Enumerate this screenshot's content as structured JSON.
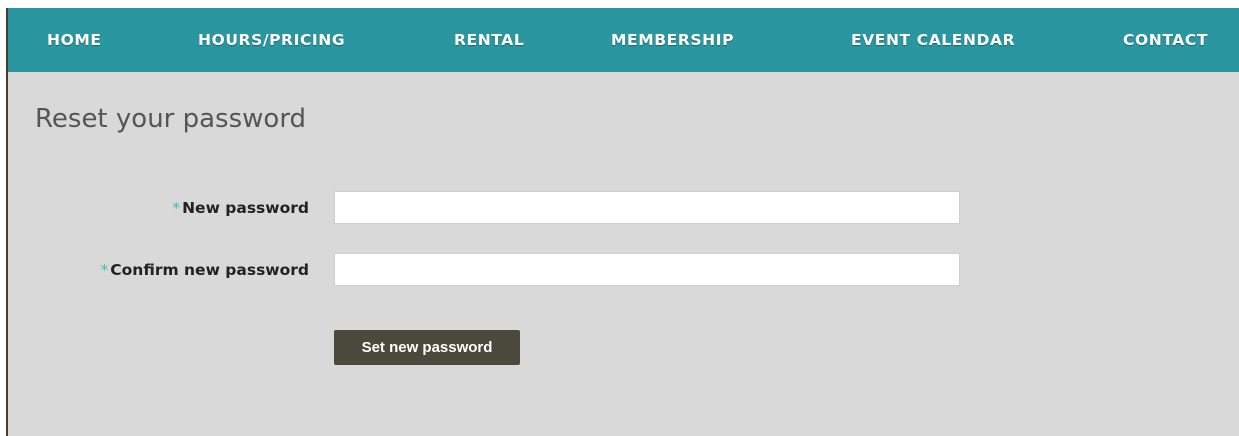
{
  "nav": {
    "items": [
      {
        "label": "HOME"
      },
      {
        "label": "HOURS/PRICING"
      },
      {
        "label": "RENTAL"
      },
      {
        "label": "MEMBERSHIP"
      },
      {
        "label": "EVENT CALENDAR"
      },
      {
        "label": "CONTACT"
      }
    ]
  },
  "page": {
    "title": "Reset your password"
  },
  "form": {
    "required_marker": "*",
    "new_password": {
      "label": "New password",
      "value": "",
      "placeholder": ""
    },
    "confirm_password": {
      "label": "Confirm new password",
      "value": "",
      "placeholder": ""
    },
    "submit_label": "Set new password"
  },
  "colors": {
    "nav_background": "#2a97a0",
    "page_background": "#d9d9d9",
    "required_marker": "#3fbfb0",
    "button_background": "#4a4a3c"
  }
}
